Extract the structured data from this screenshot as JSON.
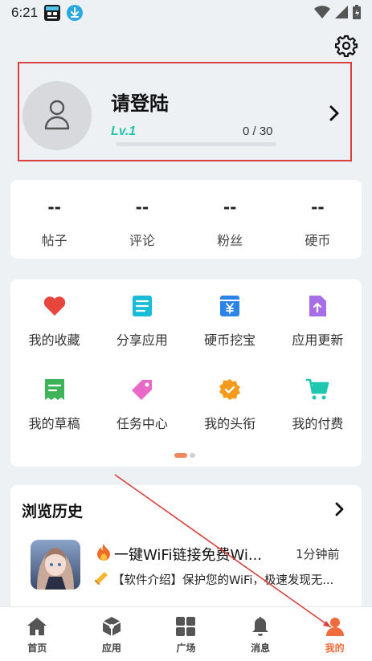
{
  "status_bar": {
    "time": "6:21",
    "icons": [
      "app-badge-icon",
      "download-icon",
      "wifi-icon",
      "signal-icon",
      "battery-icon"
    ]
  },
  "header": {
    "settings_icon": "gear-icon"
  },
  "profile": {
    "title": "请登陆",
    "level": "Lv.1",
    "exp": "0 / 30",
    "exp_progress": 0,
    "accent_color": "#23c4a9",
    "highlight_border_color": "#d8413b"
  },
  "stats": [
    {
      "value": "--",
      "label": "帖子"
    },
    {
      "value": "--",
      "label": "评论"
    },
    {
      "value": "--",
      "label": "粉丝"
    },
    {
      "value": "--",
      "label": "硬币"
    }
  ],
  "features": [
    {
      "label": "我的收藏",
      "icon": "heart-icon",
      "color": "#e8453c"
    },
    {
      "label": "分享应用",
      "icon": "document-icon",
      "color": "#19bcd6"
    },
    {
      "label": "硬币挖宝",
      "icon": "wallet-icon",
      "color": "#2d84e8"
    },
    {
      "label": "应用更新",
      "icon": "upload-icon",
      "color": "#a86ee8"
    },
    {
      "label": "我的草稿",
      "icon": "draft-icon",
      "color": "#3fb35a"
    },
    {
      "label": "任务中心",
      "icon": "tag-icon",
      "color": "#e869c8"
    },
    {
      "label": "我的头衔",
      "icon": "badge-icon",
      "color": "#f59a1b"
    },
    {
      "label": "我的付费",
      "icon": "cart-icon",
      "color": "#1fc7b0"
    }
  ],
  "pager": {
    "pages": 2,
    "active": 0
  },
  "history": {
    "title": "浏览历史",
    "items": [
      {
        "name": "一键WiFi链接免费Wi...",
        "time": "1分钟前",
        "desc": "【软件介绍】保护您的WiFi，极速发现无..."
      }
    ]
  },
  "nav": {
    "items": [
      {
        "label": "首页",
        "icon": "home-icon"
      },
      {
        "label": "应用",
        "icon": "app-cube-icon"
      },
      {
        "label": "广场",
        "icon": "grid-icon"
      },
      {
        "label": "消息",
        "icon": "bell-icon"
      },
      {
        "label": "我的",
        "icon": "user-icon"
      }
    ],
    "active": 4,
    "active_color": "#f06c3c"
  }
}
